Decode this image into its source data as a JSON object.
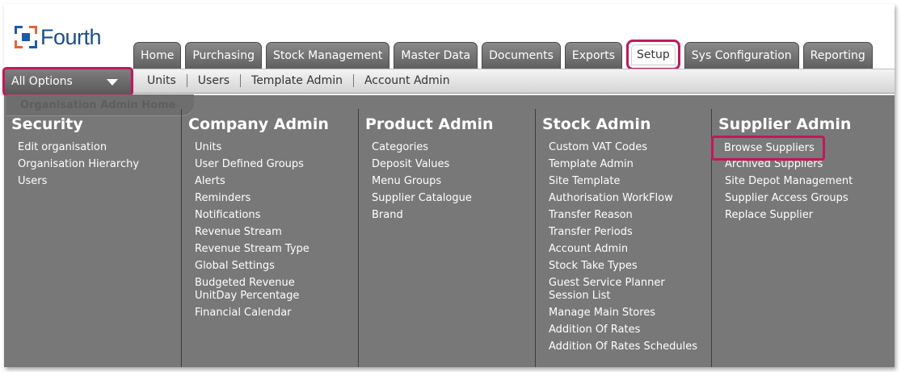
{
  "brand": {
    "name": "Fourth"
  },
  "tabs": [
    "Home",
    "Purchasing",
    "Stock Management",
    "Master Data",
    "Documents",
    "Exports",
    "Setup",
    "Sys Configuration",
    "Reporting"
  ],
  "active_tab": "Setup",
  "all_options": "All Options",
  "sublinks": [
    "Units",
    "Users",
    "Template Admin",
    "Account Admin"
  ],
  "organisation_home": "Organisation Admin Home",
  "columns": [
    {
      "title": "Security",
      "items": [
        "Edit organisation",
        "Organisation Hierarchy",
        "Users"
      ]
    },
    {
      "title": "Company Admin",
      "items": [
        "Units",
        "User Defined Groups",
        "Alerts",
        "Reminders",
        "Notifications",
        "Revenue Stream",
        "Revenue Stream Type",
        "Global Settings",
        "Budgeted Revenue UnitDay Percentage",
        "Financial Calendar"
      ]
    },
    {
      "title": "Product Admin",
      "items": [
        "Categories",
        "Deposit Values",
        "Menu Groups",
        "Supplier Catalogue",
        "Brand"
      ]
    },
    {
      "title": "Stock Admin",
      "items": [
        "Custom VAT Codes",
        "Template Admin",
        "Site Template",
        "Authorisation WorkFlow",
        "Transfer Reason",
        "Transfer Periods",
        "Account Admin",
        "Stock Take Types",
        "Guest Service Planner Session List",
        "Manage Main Stores",
        "Addition Of Rates",
        "Addition Of Rates Schedules"
      ]
    },
    {
      "title": "Supplier Admin",
      "items": [
        "Browse Suppliers",
        "Archived Suppliers",
        "Site Depot Management",
        "Supplier Access Groups",
        "Replace Supplier"
      ]
    }
  ],
  "highlight_color": "#c2185b"
}
